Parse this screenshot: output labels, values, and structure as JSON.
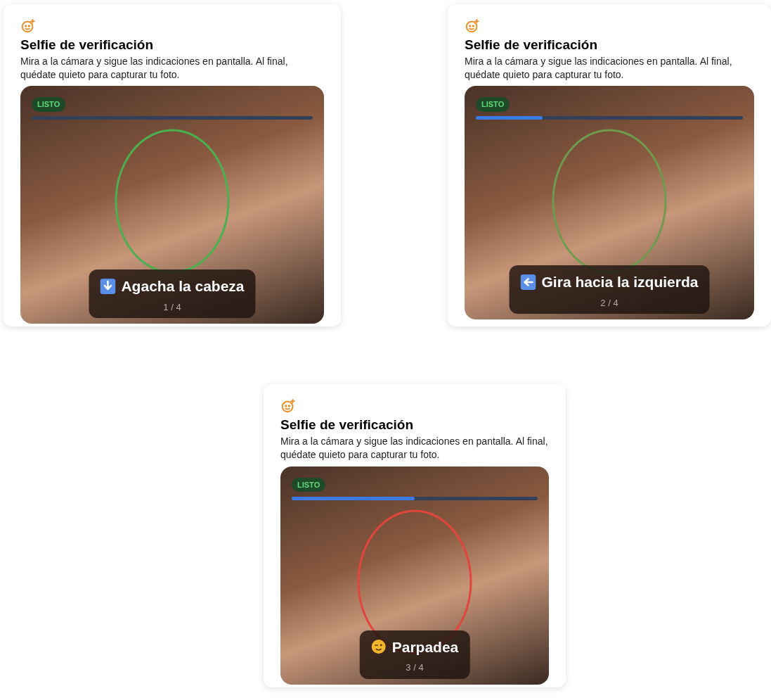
{
  "cards": [
    {
      "title": "Selfie de verificación",
      "description": "Mira a la cámara y sigue las indicaciones en pantalla. Al final, quédate quieto para capturar tu foto.",
      "badge": "LISTO",
      "progress": {
        "level": 0
      },
      "oval": {
        "color": "#4caf50"
      },
      "prompt": {
        "kind": "down",
        "text": "Agacha la cabeza",
        "step": "1 / 4"
      }
    },
    {
      "title": "Selfie de verificación",
      "description": "Mira a la cámara y sigue las indicaciones en pantalla. Al final, quédate quieto para capturar tu foto.",
      "badge": "LISTO",
      "progress": {
        "level": 0.25
      },
      "oval": {
        "color": "#6f9a4f"
      },
      "prompt": {
        "kind": "left",
        "text": "Gira hacia la izquierda",
        "step": "2 / 4"
      }
    },
    {
      "title": "Selfie de verificación",
      "description": "Mira a la cámara y sigue las indicaciones en pantalla. Al final, quédate quieto para capturar tu foto.",
      "badge": "LISTO",
      "progress": {
        "level": 0.5
      },
      "oval": {
        "color": "#e0463e"
      },
      "prompt": {
        "kind": "wink",
        "text": "Parpadea",
        "step": "3 / 4"
      }
    }
  ]
}
